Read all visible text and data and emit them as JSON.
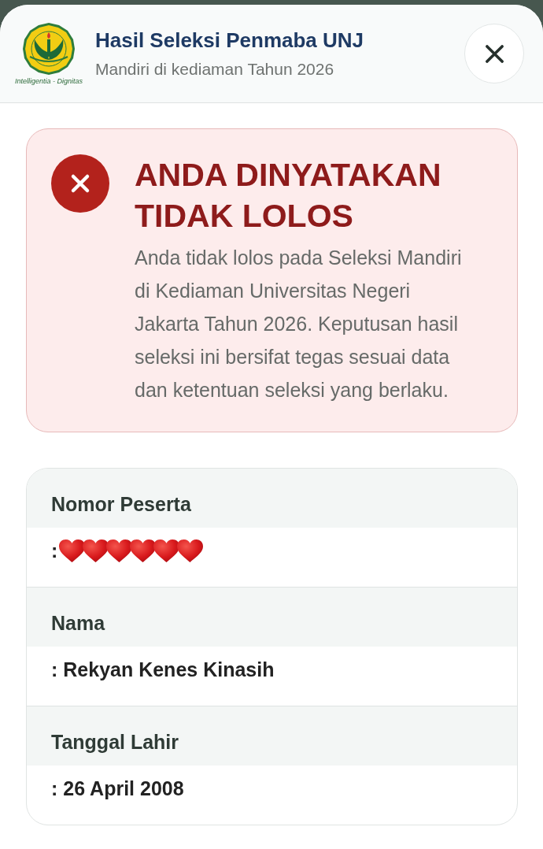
{
  "window": {
    "title": "Hasil Seleksi Penmaba UNJ",
    "subtitle": "Mandiri di kediaman Tahun 2026"
  },
  "logo": {
    "motto": "Intelligentia - Dignitas"
  },
  "result": {
    "passed": false,
    "title": "ANDA DINYATAKAN TIDAK LOLOS",
    "message": "Anda tidak lolos pada Seleksi Mandiri di Kediaman Universitas Negeri Jakarta Tahun 2026. Keputusan hasil seleksi ini bersifat tegas sesuai data dan ketentuan seleksi yang berlaku."
  },
  "fields": [
    {
      "label": "Nomor Peserta",
      "value": ":",
      "stickers": [
        {
          "kind": "heart"
        },
        {
          "kind": "heart"
        },
        {
          "kind": "heart"
        },
        {
          "kind": "heart"
        },
        {
          "kind": "heart"
        },
        {
          "kind": "heart"
        }
      ]
    },
    {
      "label": "Nama",
      "value": ": Rekyan Kenes Kinasih"
    },
    {
      "label": "Tanggal Lahir",
      "value": ": 26 April 2008"
    }
  ]
}
